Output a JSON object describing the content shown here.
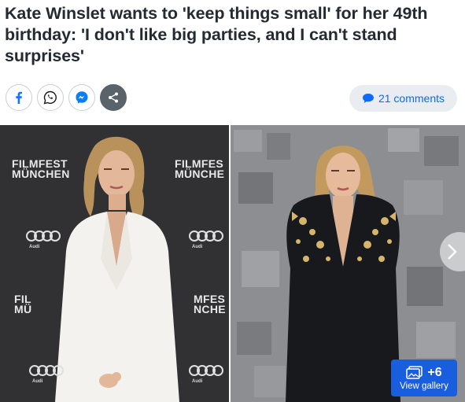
{
  "headline": "Kate Winslet wants to 'keep things small' for her 49th birthday: 'I don't like big parties, and I can't stand surprises'",
  "share": {
    "buttons": [
      "facebook",
      "whatsapp",
      "messenger",
      "share"
    ]
  },
  "comments": {
    "label": "21 comments"
  },
  "gallery": {
    "left_photo": {
      "wall_text_top_1": "FILMFEST",
      "wall_text_top_2": "MÜNCHEN",
      "wall_text_mid_1": "FIL",
      "wall_text_mid_2": "MÜ",
      "wall_text_right_1": "FILMFES",
      "wall_text_right_2": "MÜNCHE",
      "wall_text_right_3": "MFES",
      "wall_text_right_4": "NCHE",
      "audi": "Audi"
    },
    "extra_count": "+6",
    "view_label": "View gallery"
  },
  "colors": {
    "accent": "#0f69ff",
    "gallery_button": "#1a5ee0",
    "facebook": "#1877f2",
    "whatsapp": "#25d366"
  }
}
